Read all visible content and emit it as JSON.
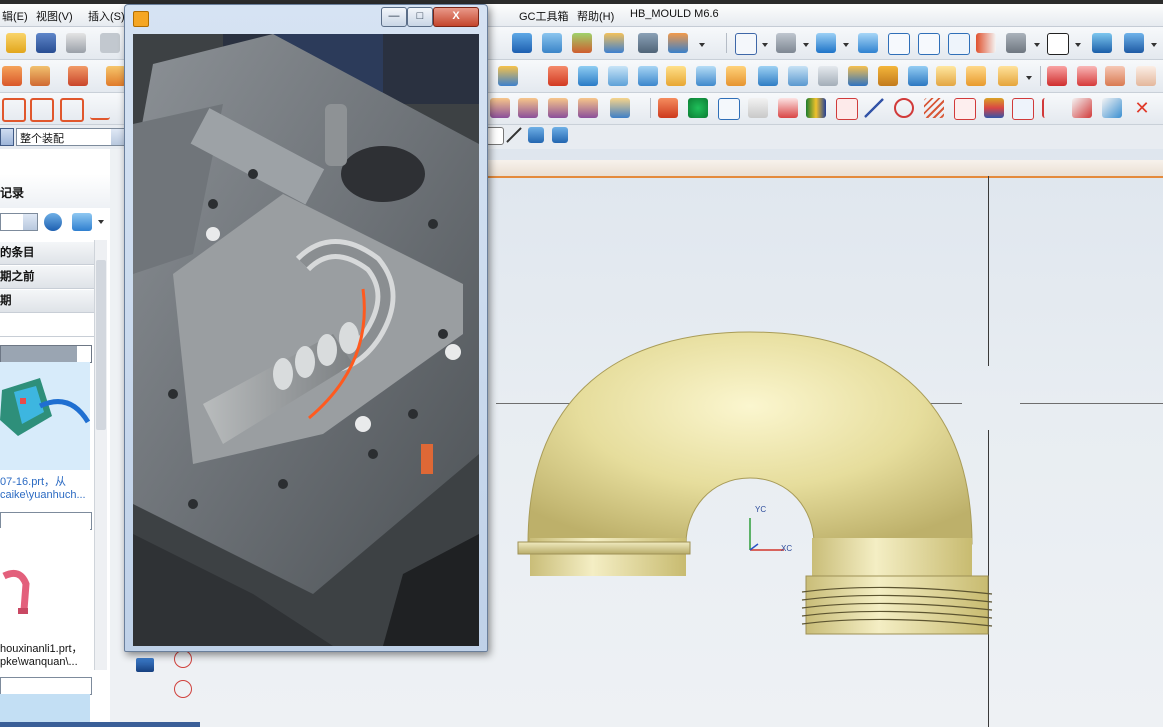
{
  "menu": {
    "items": [
      "辑(E)",
      "视图(V)",
      "插入(S)",
      "GC工具箱",
      "帮助(H)",
      "HB_MOULD M6.6"
    ]
  },
  "assembly_filter": {
    "value": "整个装配"
  },
  "navigator": {
    "title": "记录",
    "rows": [
      "的条目",
      "期之前",
      "期"
    ],
    "files": [
      {
        "name": "07-16.prt，从",
        "path": "caike\\yuanhuch..."
      },
      {
        "name": "houxinanli1.prt，",
        "path": "pke\\wanquan\\..."
      }
    ]
  },
  "viewport": {
    "triad": {
      "y_label": "YC",
      "x_label": "XC"
    },
    "model": "u-bend pipe part",
    "colors": {
      "part": "#e8e1a4",
      "background": "#e4e9ef",
      "highlight_bar": "#e48a3c"
    }
  },
  "video_window": {
    "buttons": {
      "minimize": "—",
      "maximize": "□",
      "close": "X"
    }
  }
}
